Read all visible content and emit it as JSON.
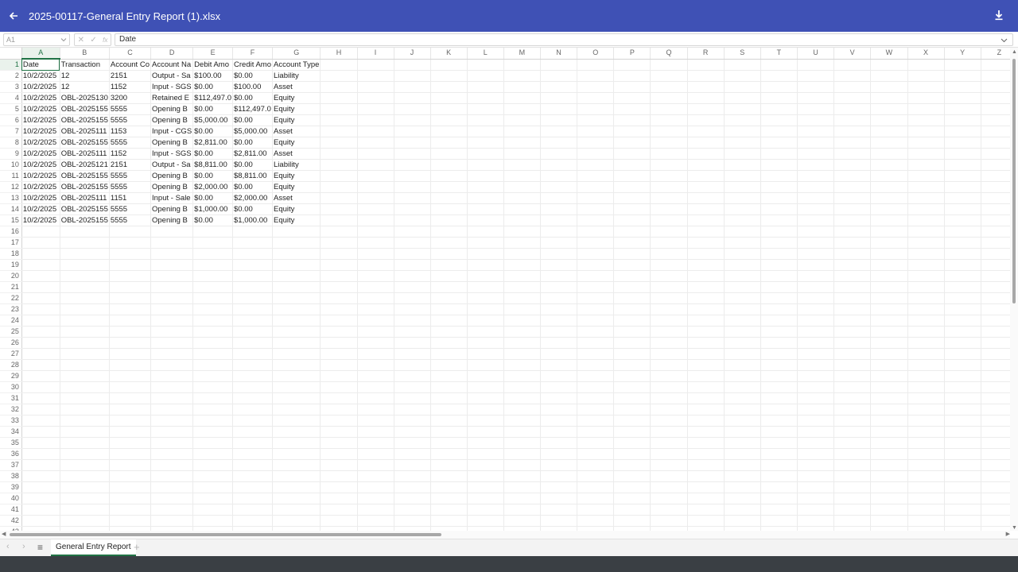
{
  "titlebar": {
    "title": "2025-00117-General Entry Report (1).xlsx"
  },
  "formula_bar": {
    "name_box": "A1",
    "fx_cancel": "✕",
    "fx_confirm": "✓",
    "fx_func": "fx",
    "content": "Date"
  },
  "columns": [
    "A",
    "B",
    "C",
    "D",
    "E",
    "F",
    "G",
    "H",
    "I",
    "J",
    "K",
    "L",
    "M",
    "N",
    "O",
    "P",
    "Q",
    "R",
    "S",
    "T",
    "U",
    "V",
    "W",
    "X",
    "Y",
    "Z"
  ],
  "row_count": 44,
  "rows": [
    [
      "Date",
      "Transaction",
      "Account Co",
      "Account Na",
      "Debit Amo",
      "Credit Amo",
      "Account Type"
    ],
    [
      "10/2/2025",
      "12",
      "2151",
      "Output - Sa",
      "$100.00",
      "$0.00",
      "Liability"
    ],
    [
      "10/2/2025",
      "12",
      "1152",
      "Input - SGS",
      "$0.00",
      "$100.00",
      "Asset"
    ],
    [
      "10/2/2025",
      "OBL-2025130",
      "3200",
      "Retained E",
      "$112,497.0",
      "$0.00",
      "Equity"
    ],
    [
      "10/2/2025",
      "OBL-2025155",
      "5555",
      "Opening B",
      "$0.00",
      "$112,497.0",
      "Equity"
    ],
    [
      "10/2/2025",
      "OBL-2025155",
      "5555",
      "Opening B",
      "$5,000.00",
      "$0.00",
      "Equity"
    ],
    [
      "10/2/2025",
      "OBL-2025111",
      "1153",
      "Input - CGS",
      "$0.00",
      "$5,000.00",
      "Asset"
    ],
    [
      "10/2/2025",
      "OBL-2025155",
      "5555",
      "Opening B",
      "$2,811.00",
      "$0.00",
      "Equity"
    ],
    [
      "10/2/2025",
      "OBL-2025111",
      "1152",
      "Input - SGS",
      "$0.00",
      "$2,811.00",
      "Asset"
    ],
    [
      "10/2/2025",
      "OBL-2025121",
      "2151",
      "Output - Sa",
      "$8,811.00",
      "$0.00",
      "Liability"
    ],
    [
      "10/2/2025",
      "OBL-2025155",
      "5555",
      "Opening B",
      "$0.00",
      "$8,811.00",
      "Equity"
    ],
    [
      "10/2/2025",
      "OBL-2025155",
      "5555",
      "Opening B",
      "$2,000.00",
      "$0.00",
      "Equity"
    ],
    [
      "10/2/2025",
      "OBL-2025111",
      "1151",
      "Input - Sale",
      "$0.00",
      "$2,000.00",
      "Asset"
    ],
    [
      "10/2/2025",
      "OBL-2025155",
      "5555",
      "Opening B",
      "$1,000.00",
      "$0.00",
      "Equity"
    ],
    [
      "10/2/2025",
      "OBL-2025155",
      "5555",
      "Opening B",
      "$0.00",
      "$1,000.00",
      "Equity"
    ]
  ],
  "sheet_tabs": {
    "active": "General Entry Report",
    "add": "+",
    "menu": "≡",
    "prev": "‹",
    "next": "›"
  },
  "colors": {
    "title_bar": "#3f51b5",
    "accent": "#217346",
    "bottom_bar": "#3a3f44"
  },
  "icons": {
    "back": "back-arrow-icon",
    "download": "download-icon"
  }
}
